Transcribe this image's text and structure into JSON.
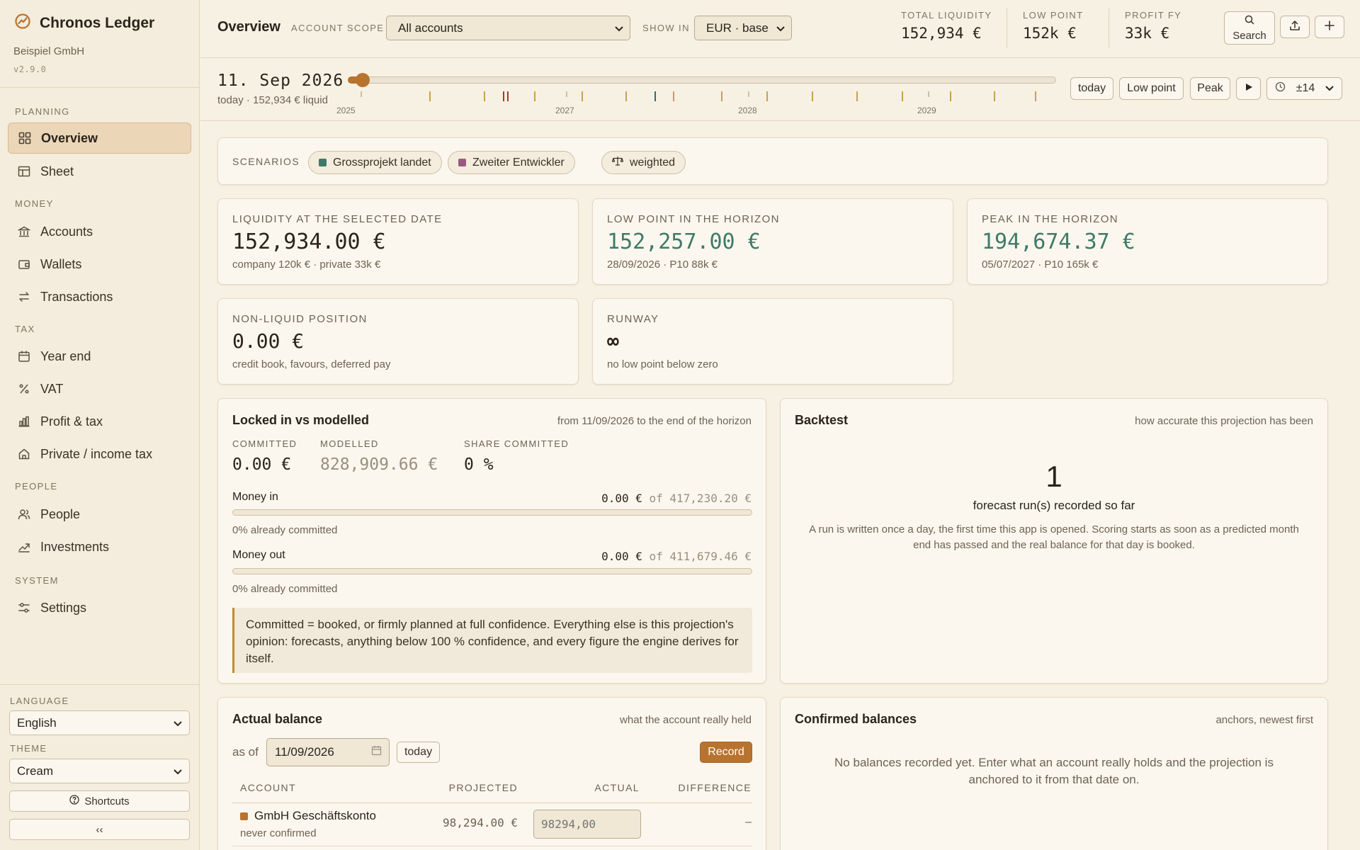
{
  "app": {
    "title": "Chronos Ledger",
    "company": "Beispiel GmbH",
    "version": "v2.9.0"
  },
  "sidebar": {
    "sections": {
      "planning": "PLANNING",
      "money": "MONEY",
      "tax": "TAX",
      "people": "PEOPLE",
      "system": "SYSTEM"
    },
    "items": {
      "overview": "Overview",
      "sheet": "Sheet",
      "accounts": "Accounts",
      "wallets": "Wallets",
      "transactions": "Transactions",
      "year_end": "Year end",
      "vat": "VAT",
      "profit_tax": "Profit & tax",
      "private_tax": "Private / income tax",
      "people": "People",
      "investments": "Investments",
      "settings": "Settings"
    },
    "language_label": "LANGUAGE",
    "language_value": "English",
    "theme_label": "THEME",
    "theme_value": "Cream",
    "shortcuts_label": "Shortcuts",
    "collapse_label": "‹‹"
  },
  "topbar": {
    "title": "Overview",
    "scope_label": "ACCOUNT SCOPE",
    "scope_value": "All accounts",
    "show_in_label": "SHOW IN",
    "show_in_value": "EUR · base",
    "stats": {
      "total_liquidity_label": "TOTAL LIQUIDITY",
      "total_liquidity_value": "152,934 €",
      "low_point_label": "LOW POINT",
      "low_point_value": "152k €",
      "profit_fy_label": "PROFIT FY",
      "profit_fy_value": "33k €"
    },
    "search_label": "Search"
  },
  "timeline": {
    "date": "11. Sep 2026",
    "sub": "today · 152,934 € liquid",
    "years": [
      "2025",
      "2027",
      "2028",
      "2029"
    ],
    "buttons": {
      "today": "today",
      "low_point": "Low point",
      "peak": "Peak",
      "window": "±14"
    }
  },
  "scenarios": {
    "label": "SCENARIOS",
    "items": [
      {
        "name": "Grossprojekt landet",
        "color": "#3f7a68"
      },
      {
        "name": "Zweiter Entwickler",
        "color": "#9a5a80"
      }
    ],
    "weighted_label": "weighted"
  },
  "kpis": {
    "liquidity": {
      "label": "LIQUIDITY AT THE SELECTED DATE",
      "value": "152,934.00 €",
      "sub": "company 120k € · private 33k €"
    },
    "low_point": {
      "label": "LOW POINT IN THE HORIZON",
      "value": "152,257.00 €",
      "sub": "28/09/2026 · P10 88k €"
    },
    "peak": {
      "label": "PEAK IN THE HORIZON",
      "value": "194,674.37 €",
      "sub": "05/07/2027 · P10 165k €"
    },
    "non_liquid": {
      "label": "NON-LIQUID POSITION",
      "value": "0.00 €",
      "sub": "credit book, favours, deferred pay"
    },
    "runway": {
      "label": "RUNWAY",
      "value": "∞",
      "sub": "no low point below zero"
    }
  },
  "locked": {
    "title": "Locked in vs modelled",
    "hint": "from 11/09/2026 to the end of the horizon",
    "committed_label": "COMMITTED",
    "committed_value": "0.00 €",
    "modelled_label": "MODELLED",
    "modelled_value": "828,909.66 €",
    "share_label": "SHARE COMMITTED",
    "share_value": "0 %",
    "money_in_label": "Money in",
    "money_in_committed": "0.00 €",
    "money_in_of": "of 417,230.20 €",
    "money_in_fraction": 0,
    "money_in_note": "0% already committed",
    "money_out_label": "Money out",
    "money_out_committed": "0.00 €",
    "money_out_of": "of 411,679.46 €",
    "money_out_fraction": 0,
    "money_out_note": "0% already committed",
    "callout": "Committed = booked, or firmly planned at full confidence. Everything else is this projection's opinion: forecasts, anything below 100 % confidence, and every figure the engine derives for itself."
  },
  "backtest": {
    "title": "Backtest",
    "hint": "how accurate this projection has been",
    "count": "1",
    "caption": "forecast run(s) recorded so far",
    "desc": "A run is written once a day, the first time this app is opened. Scoring starts as soon as a predicted month end has passed and the real balance for that day is booked."
  },
  "actual_balance": {
    "title": "Actual balance",
    "hint": "what the account really held",
    "as_of_label": "as of",
    "date_value": "11/09/2026",
    "today_label": "today",
    "record_label": "Record",
    "columns": {
      "account": "ACCOUNT",
      "projected": "PROJECTED",
      "actual": "ACTUAL",
      "difference": "DIFFERENCE"
    },
    "rows": [
      {
        "account": "GmbH Geschäftskonto",
        "status": "never confirmed",
        "projected": "98,294.00 €",
        "actual_placeholder": "98294,00",
        "difference": "–",
        "color": "#b8732f"
      }
    ]
  },
  "confirmed": {
    "title": "Confirmed balances",
    "hint": "anchors, newest first",
    "empty": "No balances recorded yet. Enter what an account really holds and the projection is anchored to it from that date on."
  },
  "colors": {
    "accent": "#b8732f",
    "positive": "#3f7a68",
    "background": "#f7f1e4"
  }
}
